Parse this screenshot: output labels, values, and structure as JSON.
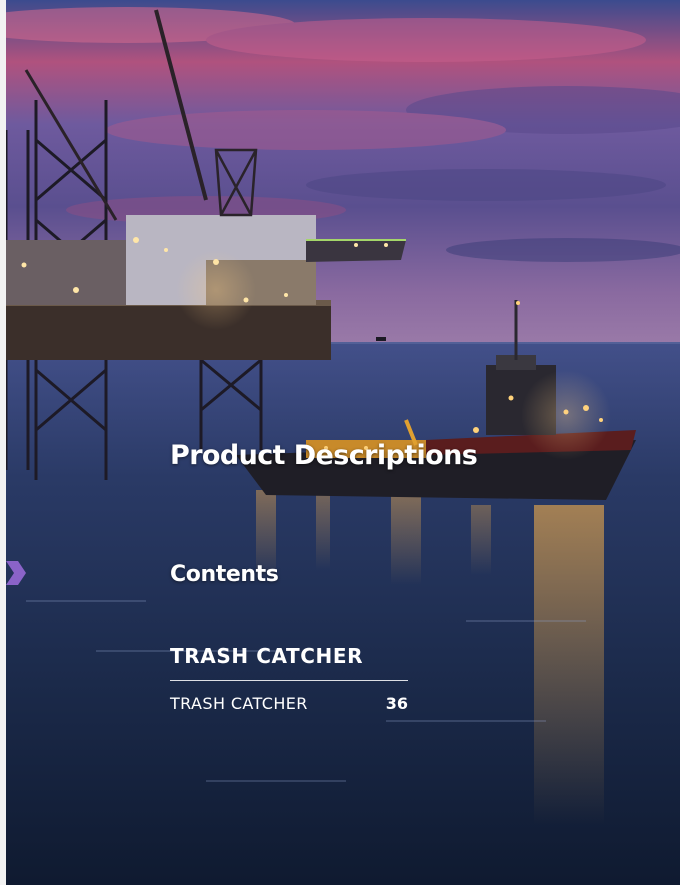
{
  "document": {
    "section_title": "Product Descriptions",
    "contents_title": "Contents",
    "toc": {
      "heading": "TRASH CATCHER",
      "entries": [
        {
          "label": "TRASH CATCHER",
          "page": "36"
        }
      ]
    }
  },
  "theme": {
    "sky_top": "#2c3a7a",
    "sky_pink": "#c35a8a",
    "sea": "#1b2c4a",
    "light_reflection": "#f0a23a",
    "bookmark_color": "#8a63c8",
    "text_color": "#ffffff"
  },
  "photo": {
    "subject-icon": "offshore-oil-rig-and-supply-vessel-at-dusk"
  }
}
